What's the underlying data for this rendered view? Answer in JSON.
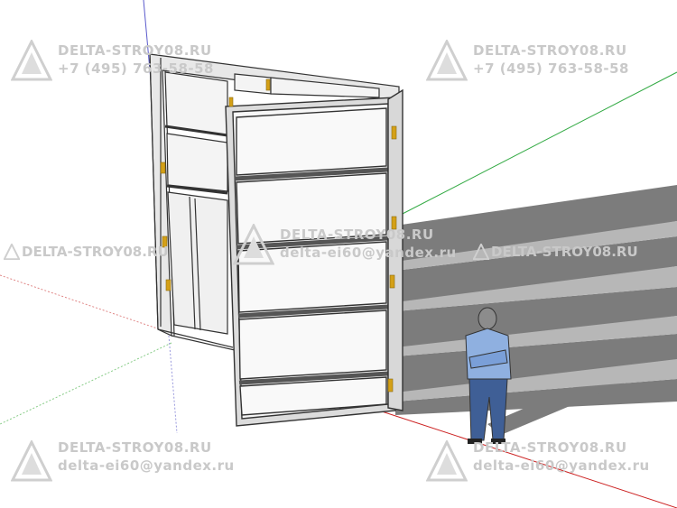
{
  "scene": {
    "background_color": "#ffffff",
    "axis_colors": {
      "red": "#cc2222",
      "green": "#22aa33",
      "blue": "#2233cc"
    },
    "shadow_color": "#7a7a7a",
    "frame_color": "#3a3a3a",
    "panel_fill": "#f5f5f5",
    "hinge_color": "#d4a017",
    "person": {
      "shirt_color": "#8fb0e0",
      "pants_color": "#3f5f96",
      "skin_color": "#8c8c8c"
    }
  },
  "watermarks": {
    "site": "DELTA-STROY08.RU",
    "phone": "+7 (495) 763-58-58",
    "email": "delta-ei60@yandex.ru",
    "logo_icon": "delta-triangle-icon",
    "color": "#c9c9c9"
  }
}
